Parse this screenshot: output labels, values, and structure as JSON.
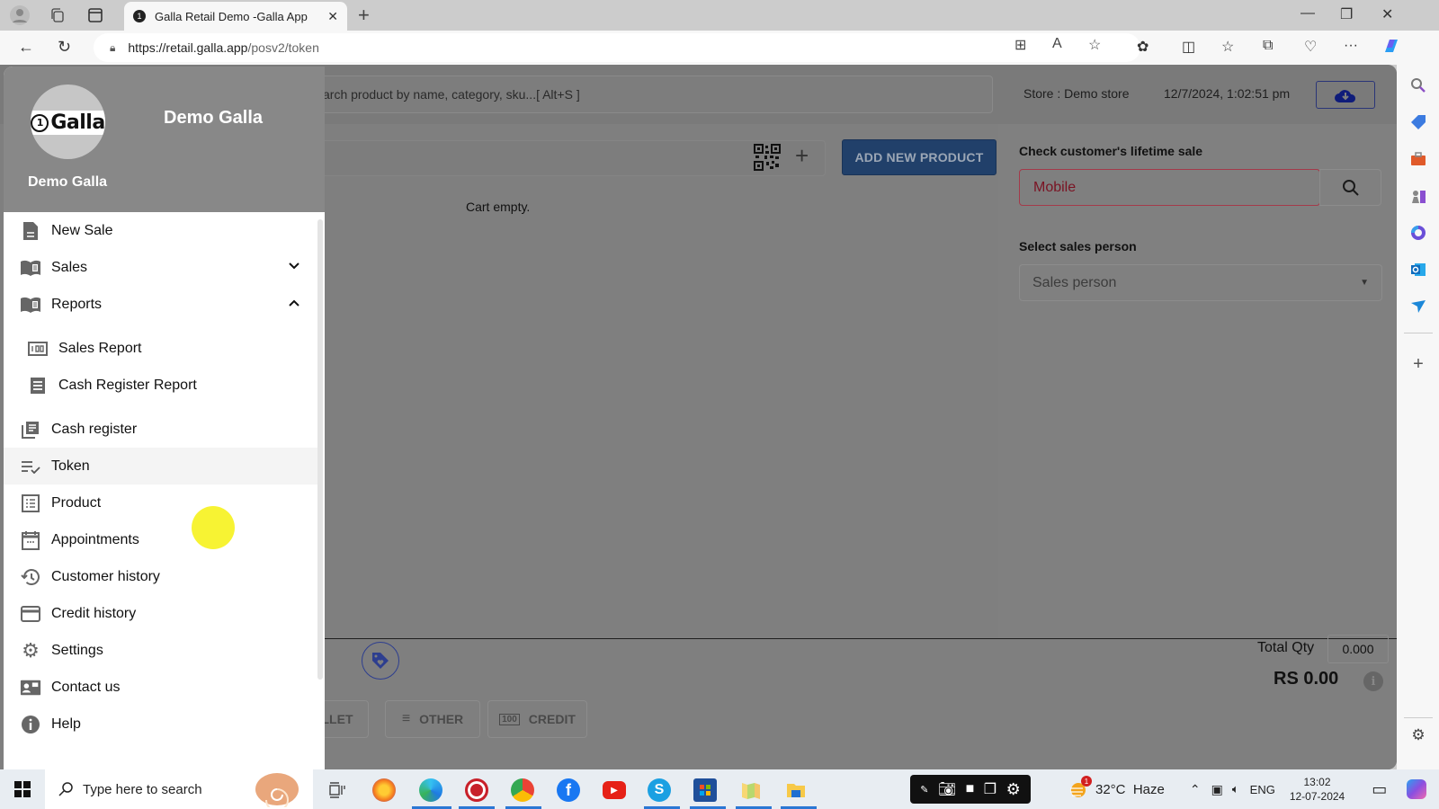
{
  "browser": {
    "tab_title": "Galla Retail Demo -Galla App",
    "url_host": "https://retail.galla.app",
    "url_path": "/posv2/token"
  },
  "topbar": {
    "search_placeholder": "Search product by name, category, sku...[ Alt+S ]",
    "search_visible_text": "arch product by name, category, sku...[ Alt+S ]",
    "store": "Store : Demo store",
    "datetime": "12/7/2024, 1:02:51 pm"
  },
  "cart": {
    "add_product_label": "ADD NEW PRODUCT",
    "empty_text": "Cart empty."
  },
  "customer": {
    "lifetime_label": "Check customer's lifetime sale",
    "mobile_placeholder": "Mobile",
    "salesperson_label": "Select sales person",
    "salesperson_placeholder": "Sales person"
  },
  "footer": {
    "payment_buttons": [
      "LLET",
      "OTHER",
      "CREDIT"
    ],
    "total_qty_label": "Total Qty",
    "total_qty": "0.000",
    "total_amount": "RS 0.00"
  },
  "drawer": {
    "header_name": "Demo Galla",
    "sub_name": "Demo Galla",
    "logo_text": "Galla",
    "menu": [
      {
        "label": "New Sale",
        "icon": "document-icon"
      },
      {
        "label": "Sales",
        "icon": "book-icon",
        "expandable": "collapsed"
      },
      {
        "label": "Reports",
        "icon": "book-icon",
        "expandable": "expanded"
      },
      {
        "label": "Sales Report",
        "icon": "report-icon",
        "sub": true
      },
      {
        "label": "Cash Register Report",
        "icon": "receipt-icon",
        "sub": true
      },
      {
        "label": "Cash register",
        "icon": "register-icon"
      },
      {
        "label": "Token",
        "icon": "checklist-icon",
        "active": true
      },
      {
        "label": "Product",
        "icon": "list-icon"
      },
      {
        "label": "Appointments",
        "icon": "calendar-icon"
      },
      {
        "label": "Customer history",
        "icon": "history-icon"
      },
      {
        "label": "Credit history",
        "icon": "credit-card-icon"
      },
      {
        "label": "Settings",
        "icon": "gear-icon"
      },
      {
        "label": "Contact us",
        "icon": "contact-icon"
      },
      {
        "label": "Help",
        "icon": "info-icon"
      }
    ]
  },
  "taskbar": {
    "search_placeholder": "Type here to search",
    "weather": "32°C  Haze",
    "weather_badge": "1",
    "language": "ENG",
    "time": "13:02",
    "date": "12-07-2024"
  },
  "colors": {
    "primary": "#21406a",
    "mobile_error": "#a43a4a",
    "overlay": "#7f7f7f"
  }
}
